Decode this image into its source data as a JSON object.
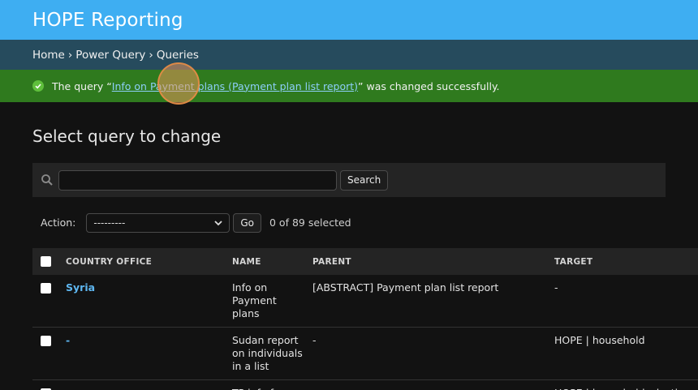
{
  "header": {
    "title": "HOPE Reporting"
  },
  "breadcrumbs": {
    "items": [
      "Home",
      "Power Query",
      "Queries"
    ],
    "separator": "›"
  },
  "message": {
    "prefix": "The query “",
    "link": "Info on Payment plans (Payment plan list report)",
    "suffix": "” was changed successfully."
  },
  "page": {
    "heading": "Select query to change"
  },
  "search": {
    "placeholder": "",
    "value": "",
    "button_label": "Search"
  },
  "actions": {
    "label": "Action:",
    "selected_option": "---------",
    "go_label": "Go",
    "selection_count": "0 of 89 selected"
  },
  "table": {
    "headers": [
      "COUNTRY OFFICE",
      "NAME",
      "PARENT",
      "TARGET"
    ],
    "rows": [
      {
        "country_office": "Syria",
        "name": "Info on Payment plans",
        "parent": "[ABSTRACT] Payment plan list report",
        "target": "-"
      },
      {
        "country_office": "-",
        "name": "Sudan report on individuals in a list",
        "parent": "-",
        "target": "HOPE | household"
      },
      {
        "country_office": "",
        "name": "TP info for",
        "parent": "",
        "target": "HOPE | householdselection"
      }
    ]
  },
  "colors": {
    "header_bg": "#3eaef2",
    "breadcrumb_bg": "#264b5d",
    "success_bg": "#2f7a1e",
    "link": "#5eb7f1",
    "page_bg": "#121212"
  }
}
